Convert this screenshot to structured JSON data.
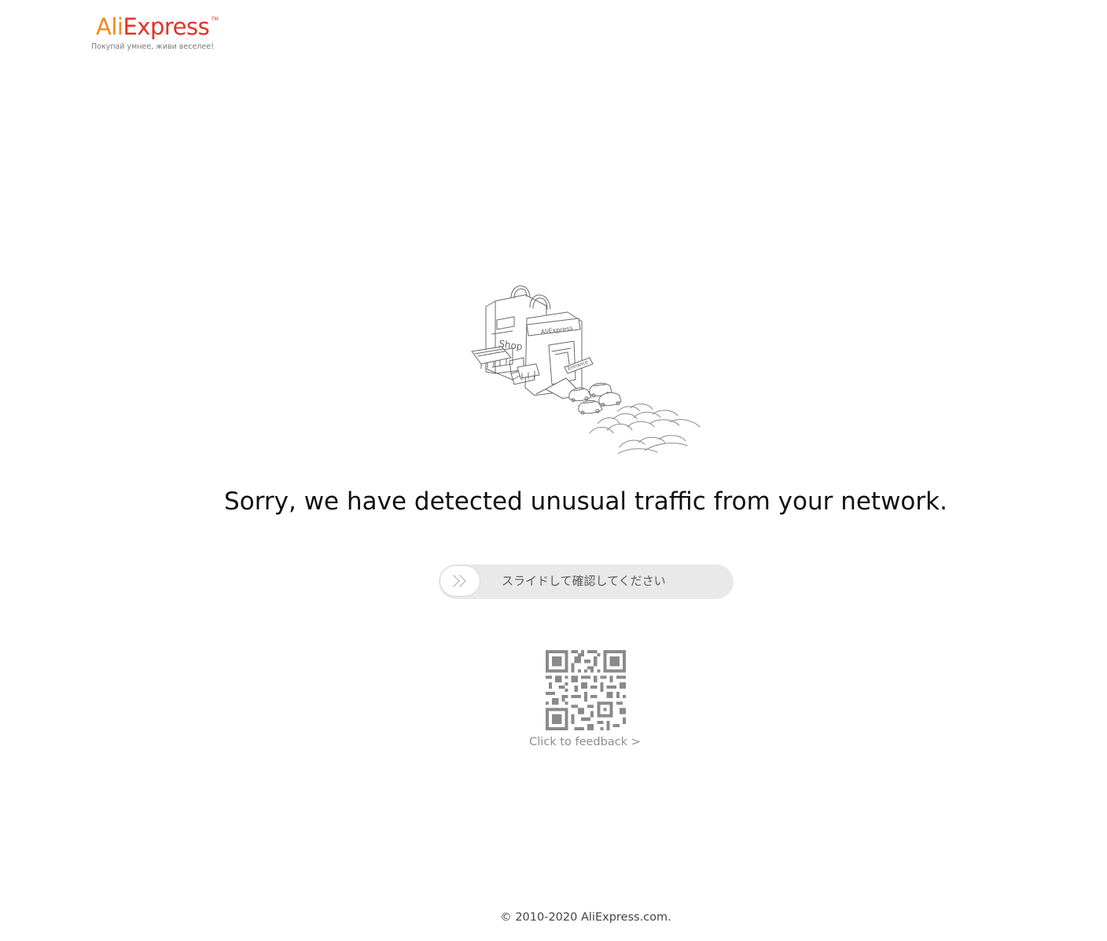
{
  "brand": {
    "logo_ali": "Ali",
    "logo_express": "Express",
    "logo_tm": "TM",
    "tagline": "Покупай умнее, живи веселее!",
    "color_orange": "#f08a1c",
    "color_red": "#e43225"
  },
  "illustration": {
    "icon": "store-traffic-illustration",
    "sign_store": "AliExpress",
    "sign_shop": "Shop",
    "sign_entrance": "Entrance"
  },
  "main": {
    "headline": "Sorry, we have detected unusual traffic from your network."
  },
  "slider": {
    "label": "スライドして確認してください",
    "handle_icon": "double-chevron-right-icon",
    "progress": 0
  },
  "feedback": {
    "qr_icon": "qr-code-icon",
    "link_text": "Click to feedback >"
  },
  "footer": {
    "copyright": "© 2010-2020 AliExpress.com."
  }
}
